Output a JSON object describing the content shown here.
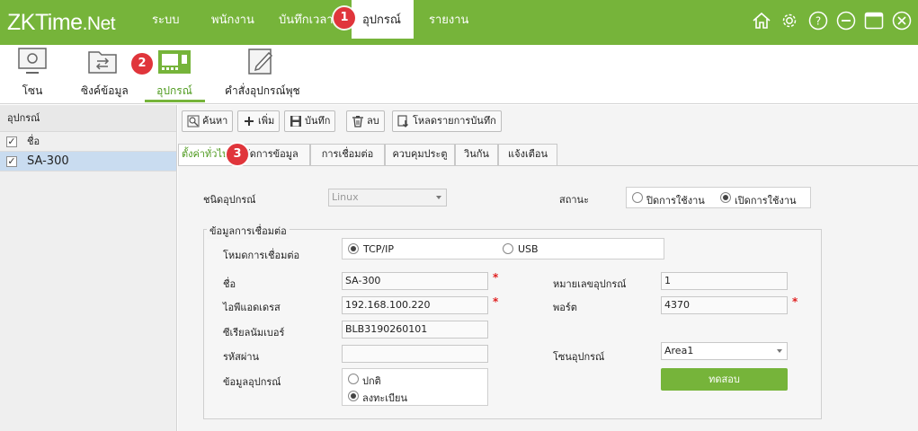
{
  "app": {
    "logo_main": "ZKTime",
    "logo_ext": ".Net",
    "menu": [
      "ระบบ",
      "พนักงาน",
      "บันทึกเวลา",
      "อุปกรณ์",
      "รายงาน"
    ],
    "active_menu": "อุปกรณ์",
    "window_controls": [
      "home-icon",
      "gear-icon",
      "help-icon",
      "minimize-icon",
      "maximize-icon",
      "close-icon"
    ],
    "accent_color": "#76b43a",
    "callout_color": "#e0353b"
  },
  "callouts": [
    "1",
    "2",
    "3"
  ],
  "toolbar": {
    "items": [
      {
        "label": "โซน",
        "icon": "monitor-icon"
      },
      {
        "label": "ซิงค์ข้อมูล",
        "icon": "sync-folder-icon"
      },
      {
        "label": "อุปกรณ์",
        "icon": "device-icon"
      },
      {
        "label": "คำสั่งอุปกรณ์พุช",
        "icon": "edit-icon"
      }
    ],
    "active": "อุปกรณ์"
  },
  "left_panel": {
    "header": "อุปกรณ์",
    "column_label": "ชื่อ",
    "devices": [
      {
        "name": "SA-300",
        "checked": true,
        "selected": true
      }
    ]
  },
  "actions": {
    "search": "ค้นหา",
    "add": "เพิ่ม",
    "save": "บันทึก",
    "delete": "ลบ",
    "download": "โหลดรายการบันทึก"
  },
  "tabs": [
    "ตั้งค่าทั่วไป",
    "จัดการข้อมูล",
    "การเชื่อมต่อ",
    "ควบคุมประตู",
    "วินกัน",
    "แจ้งเตือน"
  ],
  "active_tab": "ตั้งค่าทั่วไป",
  "form": {
    "device_type_label": "ชนิดอุปกรณ์",
    "device_type_value": "Linux",
    "status_label": "สถานะ",
    "status_options": [
      "ปิดการใช้งาน",
      "เปิดการใช้งาน"
    ],
    "status_selected": "เปิดการใช้งาน",
    "connection_group_title": "ข้อมูลการเชื่อมต่อ",
    "connection_mode_label": "โหมดการเชื่อมต่อ",
    "connection_mode_options": [
      "TCP/IP",
      "USB"
    ],
    "connection_mode_selected": "TCP/IP",
    "name_label": "ชื่อ",
    "name_value": "SA-300",
    "device_number_label": "หมายเลขอุปกรณ์",
    "device_number_value": "1",
    "ip_label": "ไอพีแอดเดรส",
    "ip_value": "192.168.100.220",
    "port_label": "พอร์ต",
    "port_value": "4370",
    "serial_label": "ซีเรียลนัมเบอร์",
    "serial_value": "BLB3190260101",
    "password_label": "รหัสผ่าน",
    "password_value": "",
    "zone_label": "โซนอุปกรณ์",
    "zone_value": "Area1",
    "device_info_label": "ข้อมูลอุปกรณ์",
    "device_info_options": [
      "ปกติ",
      "ลงทะเบียน"
    ],
    "device_info_selected": "ลงทะเบียน",
    "test_button": "ทดสอบ",
    "required_mark": "*"
  }
}
